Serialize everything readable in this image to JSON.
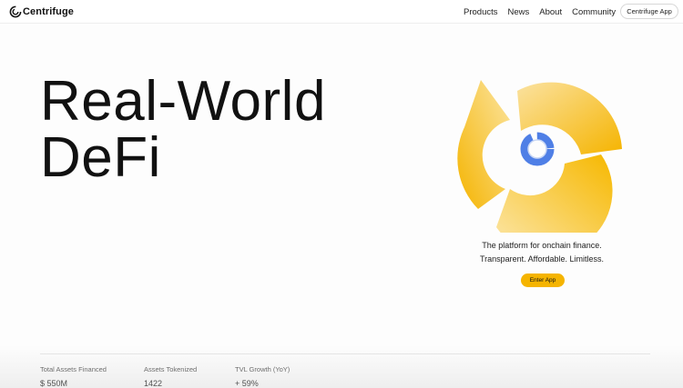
{
  "brand": {
    "name": "Centrifuge",
    "accent": "#f5b400",
    "inner_ring": "#4f7fe6"
  },
  "nav": {
    "items": [
      "Products",
      "News",
      "About",
      "Community"
    ],
    "app_button": "Centrifuge App"
  },
  "hero": {
    "title_line1": "Real-World",
    "title_line2": "DeFi",
    "tagline_line1": "The platform for onchain finance.",
    "tagline_line2": "Transparent. Affordable. Limitless.",
    "cta": "Enter App"
  },
  "stats": [
    {
      "label": "Total Assets Financed",
      "value": "$ 550M"
    },
    {
      "label": "Assets Tokenized",
      "value": "1422"
    },
    {
      "label": "TVL Growth (YoY)",
      "value": "+ 59%"
    }
  ],
  "icons": {
    "logo": "centrifuge-logo-icon",
    "hero_graphic": "swirl-graphic-icon"
  }
}
